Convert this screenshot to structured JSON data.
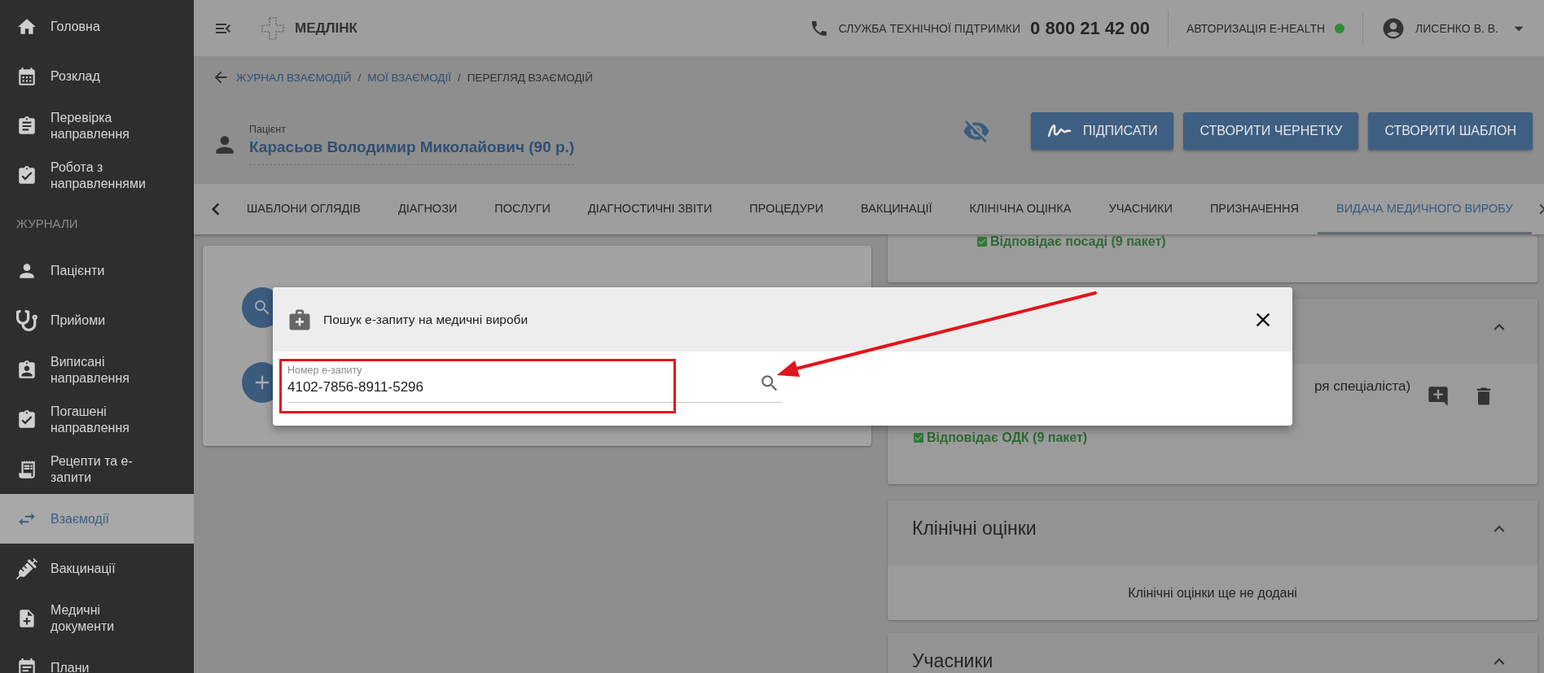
{
  "sidebar": {
    "items": [
      {
        "kind": "item",
        "label": "Головна",
        "selected": false
      },
      {
        "kind": "item",
        "label": "Розклад",
        "selected": false
      },
      {
        "kind": "item",
        "label": "Перевірка направлення",
        "selected": false
      },
      {
        "kind": "item",
        "label": "Робота з направленнями",
        "selected": false
      },
      {
        "kind": "section",
        "label": "ЖУРНАЛИ"
      },
      {
        "kind": "item",
        "label": "Пацієнти",
        "selected": false
      },
      {
        "kind": "item",
        "label": "Прийоми",
        "selected": false
      },
      {
        "kind": "item",
        "label": "Виписані направлення",
        "selected": false
      },
      {
        "kind": "item",
        "label": "Погашені направлення",
        "selected": false
      },
      {
        "kind": "item",
        "label": "Рецепти та е-запити",
        "selected": false
      },
      {
        "kind": "item",
        "label": "Взаємодії",
        "selected": true
      },
      {
        "kind": "item",
        "label": "Вакцинації",
        "selected": false
      },
      {
        "kind": "item",
        "label": "Медичні документи",
        "selected": false
      },
      {
        "kind": "item",
        "label": "Плани",
        "selected": false
      }
    ]
  },
  "header": {
    "brand": "МЕДЛІНК",
    "support_label": "СЛУЖБА ТЕХНІЧНОЇ ПІДТРИМКИ",
    "support_phone": "0 800 21 42 00",
    "ehealth_label": "АВТОРИЗАЦІЯ E-HEALTH",
    "ehealth_connected": true,
    "user": "ЛИСЕНКО В. В."
  },
  "breadcrumb": {
    "separator": "/",
    "items": [
      {
        "label": "ЖУРНАЛ ВЗАЄМОДІЙ",
        "link": true
      },
      {
        "label": "МОЇ ВЗАЄМОДІЇ",
        "link": true
      },
      {
        "label": "ПЕРЕГЛЯД ВЗАЄМОДІЙ",
        "link": false
      }
    ]
  },
  "patient": {
    "label": "Пацієнт",
    "name": "Карасьов Володимир Миколайович (90 р.)"
  },
  "actions": [
    {
      "kind": "sign",
      "label": "ПІДПИСАТИ"
    },
    {
      "kind": "plain",
      "label": "СТВОРИТИ ЧЕРНЕТКУ"
    },
    {
      "kind": "plain",
      "label": "СТВОРИТИ ШАБЛОН"
    }
  ],
  "tabs": [
    {
      "label": "ШАБЛОНИ ОГЛЯДІВ",
      "selected": false
    },
    {
      "label": "ДІАГНОЗИ",
      "selected": false
    },
    {
      "label": "ПОСЛУГИ",
      "selected": false
    },
    {
      "label": "ДІАГНОСТИЧНІ ЗВІТИ",
      "selected": false
    },
    {
      "label": "ПРОЦЕДУРИ",
      "selected": false
    },
    {
      "label": "ВАКЦИНАЦІЇ",
      "selected": false
    },
    {
      "label": "КЛІНІЧНА ОЦІНКА",
      "selected": false
    },
    {
      "label": "УЧАСНИКИ",
      "selected": false
    },
    {
      "label": "ПРИЗНАЧЕННЯ",
      "selected": false
    },
    {
      "label": "ВИДАЧА МЕДИЧНОГО ВИРОБУ",
      "selected": true
    }
  ],
  "right_panel": {
    "top_card": {
      "status": "Відповідає посаді (9 пакет)"
    },
    "referral_card": {
      "expanded": true,
      "text": "ря спеціаліста)",
      "status": "Відповідає ОДК (9 пакет)"
    },
    "sections": [
      {
        "title": "Клінічні оцінки",
        "expanded": true,
        "empty": "Клінічні оцінки ще не додані"
      },
      {
        "title": "Учасники",
        "expanded": true
      }
    ]
  },
  "dialog": {
    "title": "Пошук е-запиту на медичні вироби",
    "field": {
      "label": "Номер е-запиту",
      "value": "4102-7856-8911-5296"
    }
  }
}
